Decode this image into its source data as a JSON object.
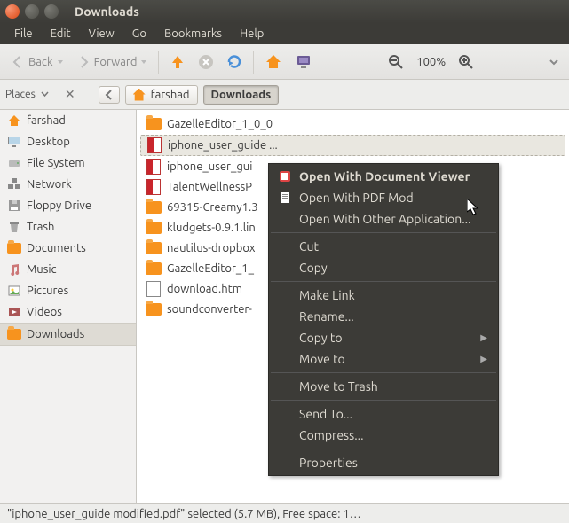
{
  "window": {
    "title": "Downloads"
  },
  "menus": [
    "File",
    "Edit",
    "View",
    "Go",
    "Bookmarks",
    "Help"
  ],
  "toolbar": {
    "back": "Back",
    "forward": "Forward",
    "zoom": "100%"
  },
  "path": {
    "home": "farshad",
    "current": "Downloads"
  },
  "sidebar": {
    "header": "Places",
    "items": [
      {
        "label": "farshad",
        "icon": "home"
      },
      {
        "label": "Desktop",
        "icon": "desktop"
      },
      {
        "label": "File System",
        "icon": "disk"
      },
      {
        "label": "Network",
        "icon": "network"
      },
      {
        "label": "Floppy Drive",
        "icon": "floppy"
      },
      {
        "label": "Trash",
        "icon": "trash"
      },
      {
        "label": "Documents",
        "icon": "folder"
      },
      {
        "label": "Music",
        "icon": "music"
      },
      {
        "label": "Pictures",
        "icon": "pictures"
      },
      {
        "label": "Videos",
        "icon": "videos"
      },
      {
        "label": "Downloads",
        "icon": "downloads",
        "selected": true
      }
    ]
  },
  "files": [
    {
      "name": "GazelleEditor_1_0_0",
      "icon": "folder"
    },
    {
      "name": "iphone_user_guide ...",
      "icon": "pdf",
      "selected": true
    },
    {
      "name": "iphone_user_gui",
      "icon": "pdf"
    },
    {
      "name": "TalentWellnessP",
      "icon": "pdf"
    },
    {
      "name": "69315-Creamy1.3",
      "icon": "folder"
    },
    {
      "name": "kludgets-0.9.1.lin",
      "icon": "folder"
    },
    {
      "name": "nautilus-dropbox",
      "icon": "folder"
    },
    {
      "name": "GazelleEditor_1_",
      "icon": "folder"
    },
    {
      "name": "download.htm",
      "icon": "htm"
    },
    {
      "name": "soundconverter-",
      "icon": "folder"
    }
  ],
  "context": {
    "groups": [
      [
        {
          "label": "Open With Document Viewer",
          "default": true,
          "icon": "app"
        },
        {
          "label": "Open With PDF Mod",
          "icon": "doc"
        },
        {
          "label": "Open With Other Application..."
        }
      ],
      [
        {
          "label": "Cut"
        },
        {
          "label": "Copy"
        }
      ],
      [
        {
          "label": "Make Link"
        },
        {
          "label": "Rename..."
        },
        {
          "label": "Copy to",
          "submenu": true
        },
        {
          "label": "Move to",
          "submenu": true
        }
      ],
      [
        {
          "label": "Move to Trash"
        }
      ],
      [
        {
          "label": "Send To..."
        },
        {
          "label": "Compress..."
        }
      ],
      [
        {
          "label": "Properties"
        }
      ]
    ]
  },
  "status": "\"iphone_user_guide modified.pdf\" selected (5.7 MB), Free space: 1…"
}
